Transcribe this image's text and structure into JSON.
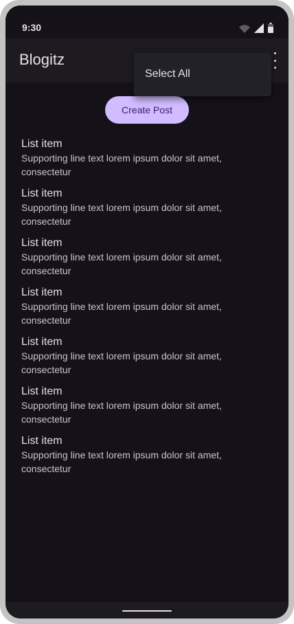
{
  "status_bar": {
    "time": "9:30"
  },
  "app_bar": {
    "title": "Blogitz"
  },
  "menu": {
    "items": [
      {
        "label": "Select All"
      }
    ]
  },
  "actions": {
    "create_post_label": "Create Post"
  },
  "list": {
    "items": [
      {
        "title": "List item",
        "supporting": "Supporting line text lorem ipsum dolor sit amet, consectetur"
      },
      {
        "title": "List item",
        "supporting": "Supporting line text lorem ipsum dolor sit amet, consectetur"
      },
      {
        "title": "List item",
        "supporting": "Supporting line text lorem ipsum dolor sit amet, consectetur"
      },
      {
        "title": "List item",
        "supporting": "Supporting line text lorem ipsum dolor sit amet, consectetur"
      },
      {
        "title": "List item",
        "supporting": "Supporting line text lorem ipsum dolor sit amet, consectetur"
      },
      {
        "title": "List item",
        "supporting": "Supporting line text lorem ipsum dolor sit amet, consectetur"
      },
      {
        "title": "List item",
        "supporting": "Supporting line text lorem ipsum dolor sit amet, consectetur"
      }
    ]
  },
  "icons": {
    "status": [
      "wifi-icon",
      "signal-icon",
      "battery-icon"
    ],
    "app_bar": [
      "more-vert-icon"
    ]
  },
  "colors": {
    "background": "#141218",
    "surface": "#1d1b20",
    "menu_surface": "#232128",
    "primary_container": "#d0bcff",
    "on_primary_container": "#381e72",
    "on_surface": "#e6e1e5",
    "on_surface_variant": "#cac4d0"
  }
}
